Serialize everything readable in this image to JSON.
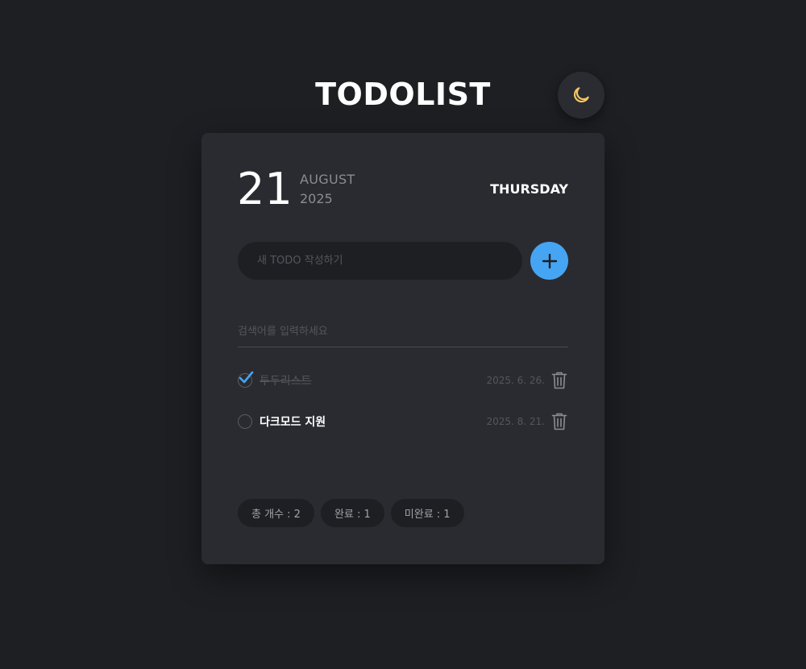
{
  "header": {
    "title": "TODOLIST",
    "theme_icon": "moon-icon"
  },
  "date": {
    "day": "21",
    "month": "AUGUST",
    "year": "2025",
    "weekday": "THURSDAY"
  },
  "new_todo": {
    "placeholder": "새 TODO 작성하기",
    "value": "",
    "add_icon": "plus-icon"
  },
  "search": {
    "placeholder": "검색어를 입력하세요",
    "value": ""
  },
  "todos": [
    {
      "text": "투두리스트",
      "date": "2025. 6. 26.",
      "done": true
    },
    {
      "text": "다크모드 지원",
      "date": "2025. 8. 21.",
      "done": false
    }
  ],
  "stats": {
    "total": "총 개수 : 2",
    "done": "완료 : 1",
    "undone": "미완료 : 1"
  },
  "colors": {
    "background": "#1e1f23",
    "card": "#2a2b30",
    "accent": "#46a5f2",
    "moon": "#f4c662"
  }
}
